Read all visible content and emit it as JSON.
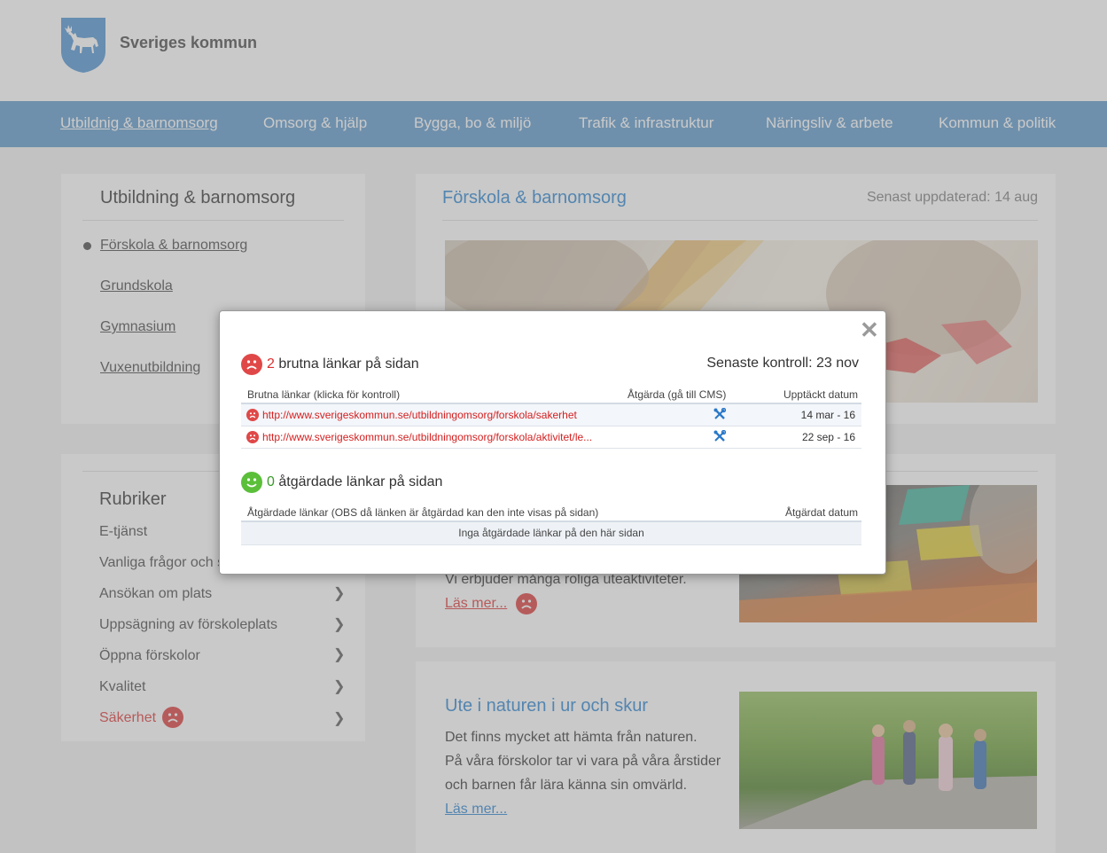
{
  "header": {
    "site_name": "Sveriges kommun"
  },
  "nav": [
    "Utbildnig & barnomsorg",
    "Omsorg & hjälp",
    "Bygga, bo & miljö",
    "Trafik & infrastruktur",
    "Näringsliv & arbete",
    "Kommun & politik"
  ],
  "sidebar": {
    "title": "Utbildning & barnomsorg",
    "links": [
      "Förskola & barnomsorg",
      "Grundskola",
      "Gymnasium",
      "Vuxenutbildning"
    ]
  },
  "rubriker": {
    "title": "Rubriker",
    "items": [
      "E-tjänst",
      "Vanliga frågor och s",
      "Ansökan om plats",
      "Uppsägning av förskoleplats",
      "Öppna förskolor",
      "Kvalitet",
      "Säkerhet"
    ]
  },
  "main": {
    "title": "Förskola & barnomsorg",
    "updated": "Senast uppdaterad: 14 aug",
    "card1": {
      "text": "Vi erbjuder många roliga uteaktiviteter.",
      "read_more": "Läs mer..."
    },
    "card2": {
      "title": "Ute i naturen i ur och skur",
      "lines": [
        "Det finns mycket att hämta från naturen.",
        "På våra förskolor tar vi vara på våra årstider",
        "och barnen får lära känna sin omvärld."
      ],
      "read_more": "Läs mer..."
    }
  },
  "modal": {
    "broken_count": "2",
    "broken_label": "brutna länkar på sidan",
    "last_check": "Senaste kontroll: 23 nov",
    "col_links": "Brutna länkar (klicka för kontroll)",
    "col_action": "Åtgärda (gå till CMS)",
    "col_found": "Upptäckt datum",
    "rows": [
      {
        "url": "http://www.sverigeskommun.se/utbildningomsorg/forskola/sakerhet",
        "date": "14 mar - 16"
      },
      {
        "url": "http://www.sverigeskommun.se/utbildningomsorg/forskola/aktivitet/le...",
        "date": "22 sep - 16"
      }
    ],
    "fixed_count": "0",
    "fixed_label": "åtgärdade länkar på sidan",
    "col_fixed": "Åtgärdade länkar (OBS då länken är åtgärdad kan den inte visas på sidan)",
    "col_fixed_date": "Åtgärdat datum",
    "empty": "Inga åtgärdade länkar på den här sidan",
    "close_symbol": "✕"
  },
  "colors": {
    "nav": "#6aa0cf",
    "link_blue": "#3b8ed6",
    "broken_red": "#d42020",
    "sad_face": "#e04848",
    "happy_face": "#5bbf3a"
  },
  "icons": [
    "moose-shield-logo",
    "sad-face-icon",
    "happy-face-icon",
    "wrench-icon",
    "chevron-right-icon",
    "close-icon"
  ]
}
